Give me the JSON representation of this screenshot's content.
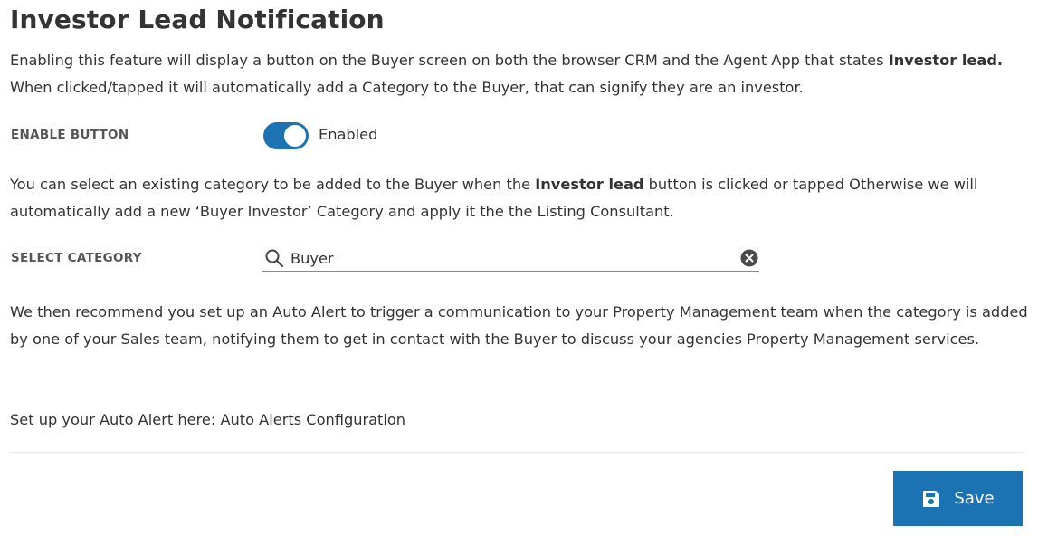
{
  "title": "Investor Lead Notification",
  "intro": {
    "text_before": "Enabling this feature will display a button on the Buyer screen on both the browser CRM and the Agent App that states ",
    "bold": "Investor lead.",
    "text_after": " When clicked/tapped it will automatically add a Category to the Buyer, that can signify they are an investor."
  },
  "enable_button": {
    "label": "ENABLE BUTTON",
    "enabled": true,
    "status_text": "Enabled"
  },
  "category_info": {
    "text_before": "You can select an existing category to be added to the Buyer when the ",
    "bold": "Investor lead",
    "text_after": " button is clicked or tapped Otherwise we will automatically add a new ‘Buyer Investor’ Category and apply it the the Listing Consultant."
  },
  "select_category": {
    "label": "SELECT CATEGORY",
    "value": "Buyer"
  },
  "recommendation": "We then recommend you set up an Auto Alert to trigger a communication to your Property Management team when the category is added by one of your Sales team, notifying them to get in contact with the Buyer to discuss your agencies Property Management services.",
  "auto_alert": {
    "prefix": "Set up your Auto Alert here: ",
    "link_text": "Auto Alerts Configuration"
  },
  "save_label": "Save",
  "colors": {
    "accent": "#1b73b3",
    "text": "#333333",
    "label": "#555555"
  },
  "icons": {
    "search": "search-icon",
    "clear": "clear-circle-x-icon",
    "save": "floppy-disk-icon"
  }
}
